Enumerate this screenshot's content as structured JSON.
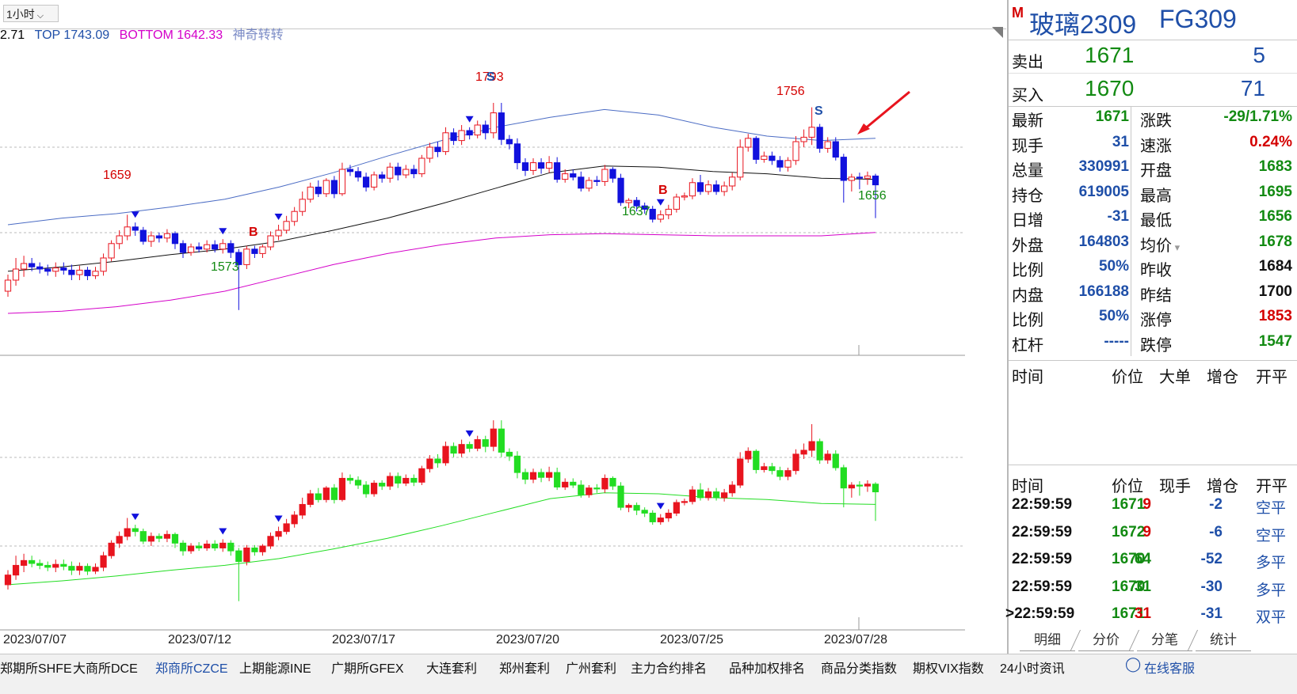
{
  "toolbar": {
    "period": "1小时"
  },
  "indicator": {
    "value": "2.71",
    "top_label": "TOP",
    "top_value": "1743.09",
    "bottom_label": "BOTTOM",
    "bottom_value": "1642.33",
    "name": "神奇转转"
  },
  "instrument": {
    "logo": "M",
    "name": "玻璃2309",
    "code": "FG309"
  },
  "orderbook": {
    "ask": {
      "label": "卖出",
      "price": "1671",
      "volume": "5"
    },
    "bid": {
      "label": "买入",
      "price": "1670",
      "volume": "71"
    }
  },
  "stats": [
    {
      "l": "最新",
      "v": "1671",
      "vc": "#128a12",
      "l2": "涨跌",
      "v2": "-29/1.71%",
      "v2c": "#128a12"
    },
    {
      "l": "现手",
      "v": "31",
      "vc": "#1f4fa8",
      "l2": "速涨",
      "v2": "0.24%",
      "v2c": "#d40000"
    },
    {
      "l": "总量",
      "v": "330991",
      "vc": "#1f4fa8",
      "l2": "开盘",
      "v2": "1683",
      "v2c": "#128a12"
    },
    {
      "l": "持仓",
      "v": "619005",
      "vc": "#1f4fa8",
      "l2": "最高",
      "v2": "1695",
      "v2c": "#128a12"
    },
    {
      "l": "日增",
      "v": "-31",
      "vc": "#1f4fa8",
      "l2": "最低",
      "v2": "1656",
      "v2c": "#128a12"
    },
    {
      "l": "外盘",
      "v": "164803",
      "vc": "#1f4fa8",
      "l2": "均价",
      "v2": "1678",
      "v2c": "#128a12"
    },
    {
      "l": "比例",
      "v": "50%",
      "vc": "#1f4fa8",
      "l2": "昨收",
      "v2": "1684",
      "v2c": "#111111"
    },
    {
      "l": "内盘",
      "v": "166188",
      "vc": "#1f4fa8",
      "l2": "昨结",
      "v2": "1700",
      "v2c": "#111111"
    },
    {
      "l": "比例",
      "v": "50%",
      "vc": "#1f4fa8",
      "l2": "涨停",
      "v2": "1853",
      "v2c": "#d40000"
    },
    {
      "l": "杠杆",
      "v": "-----",
      "vc": "#1f4fa8",
      "l2": "跌停",
      "v2": "1547",
      "v2c": "#128a12"
    }
  ],
  "bigorders": {
    "headers": [
      "时间",
      "价位",
      "大单",
      "增仓",
      "开平"
    ]
  },
  "ticks": {
    "headers": [
      "时间",
      "价位",
      "现手",
      "增仓",
      "开平"
    ],
    "rows": [
      {
        "time": "22:59:59",
        "price": "1671",
        "vol": "9",
        "volc": "#d40000",
        "oi": "-2",
        "type": "空平",
        "typec": "#1f4fa8",
        "cursor": ""
      },
      {
        "time": "22:59:59",
        "price": "1672",
        "vol": "9",
        "volc": "#d40000",
        "oi": "-6",
        "type": "空平",
        "typec": "#1f4fa8",
        "cursor": ""
      },
      {
        "time": "22:59:59",
        "price": "1670",
        "vol": "64",
        "volc": "#128a12",
        "oi": "-52",
        "type": "多平",
        "typec": "#1f4fa8",
        "cursor": ""
      },
      {
        "time": "22:59:59",
        "price": "1670",
        "vol": "31",
        "volc": "#128a12",
        "oi": "-30",
        "type": "多平",
        "typec": "#1f4fa8",
        "cursor": ""
      },
      {
        "time": "22:59:59",
        "price": "1671",
        "vol": "31",
        "volc": "#d40000",
        "oi": "-31",
        "type": "双平",
        "typec": "#1f4fa8",
        "cursor": ">"
      }
    ]
  },
  "tabs": [
    "明细",
    "分价",
    "分笔",
    "统计"
  ],
  "xaxis": [
    "2023/07/07",
    "2023/07/12",
    "2023/07/17",
    "2023/07/20",
    "2023/07/25",
    "2023/07/28"
  ],
  "statusbar": [
    "郑期所SHFE",
    "大商所DCE",
    "郑商所CZCE",
    "上期能源INE",
    "广期所GFEX",
    "大连套利",
    "郑州套利",
    "广州套利",
    "主力合约排名",
    "品种加权排名",
    "商品分类指数",
    "期权VIX指数",
    "24小时资讯",
    "在线客服"
  ],
  "colors": {
    "up": "#e8141e",
    "down": "#1111dd",
    "up_lower": "#e8141e",
    "down_lower": "#22dd22",
    "band_top": "#4b6cc4",
    "band_bottom": "#d400c9",
    "mid": "#111111",
    "status_highlight": "#1f4fa8"
  },
  "annotations": [
    "1659",
    "1573",
    "1793",
    "1637",
    "1756",
    "1656",
    "B",
    "B",
    "S",
    "S"
  ],
  "chart_data": {
    "type": "candlestick",
    "title": "",
    "ylim": [
      1540,
      1810
    ],
    "candles": [
      [
        1590,
        1600,
        1585,
        1605
      ],
      [
        1600,
        1610,
        1595,
        1620
      ],
      [
        1610,
        1615,
        1603,
        1622
      ],
      [
        1615,
        1612,
        1608,
        1620
      ],
      [
        1612,
        1610,
        1606,
        1616
      ],
      [
        1610,
        1608,
        1604,
        1614
      ],
      [
        1608,
        1611,
        1603,
        1616
      ],
      [
        1611,
        1609,
        1605,
        1616
      ],
      [
        1609,
        1605,
        1600,
        1614
      ],
      [
        1605,
        1609,
        1600,
        1613
      ],
      [
        1609,
        1604,
        1600,
        1612
      ],
      [
        1604,
        1608,
        1601,
        1612
      ],
      [
        1608,
        1620,
        1604,
        1624
      ],
      [
        1620,
        1633,
        1617,
        1636
      ],
      [
        1633,
        1640,
        1628,
        1645
      ],
      [
        1640,
        1648,
        1636,
        1659
      ],
      [
        1648,
        1645,
        1640,
        1652
      ],
      [
        1645,
        1635,
        1632,
        1648
      ],
      [
        1635,
        1640,
        1630,
        1644
      ],
      [
        1640,
        1638,
        1634,
        1643
      ],
      [
        1638,
        1642,
        1634,
        1646
      ],
      [
        1642,
        1633,
        1628,
        1644
      ],
      [
        1633,
        1625,
        1620,
        1636
      ],
      [
        1625,
        1630,
        1622,
        1633
      ],
      [
        1630,
        1628,
        1625,
        1634
      ],
      [
        1628,
        1632,
        1625,
        1636
      ],
      [
        1632,
        1628,
        1625,
        1636
      ],
      [
        1628,
        1633,
        1624,
        1637
      ],
      [
        1633,
        1625,
        1620,
        1636
      ],
      [
        1625,
        1614,
        1573,
        1628
      ],
      [
        1614,
        1628,
        1610,
        1631
      ],
      [
        1628,
        1624,
        1620,
        1631
      ],
      [
        1624,
        1630,
        1620,
        1632
      ],
      [
        1630,
        1640,
        1627,
        1644
      ],
      [
        1640,
        1645,
        1636,
        1650
      ],
      [
        1645,
        1653,
        1642,
        1658
      ],
      [
        1653,
        1662,
        1649,
        1666
      ],
      [
        1662,
        1673,
        1658,
        1680
      ],
      [
        1673,
        1684,
        1670,
        1688
      ],
      [
        1684,
        1678,
        1675,
        1690
      ],
      [
        1678,
        1690,
        1675,
        1692
      ],
      [
        1690,
        1678,
        1674,
        1694
      ],
      [
        1678,
        1700,
        1676,
        1706
      ],
      [
        1700,
        1698,
        1694,
        1704
      ],
      [
        1698,
        1693,
        1689,
        1702
      ],
      [
        1693,
        1684,
        1680,
        1697
      ],
      [
        1684,
        1695,
        1681,
        1698
      ],
      [
        1695,
        1692,
        1688,
        1698
      ],
      [
        1692,
        1702,
        1688,
        1706
      ],
      [
        1702,
        1695,
        1690,
        1706
      ],
      [
        1695,
        1700,
        1692,
        1704
      ],
      [
        1700,
        1696,
        1692,
        1704
      ],
      [
        1696,
        1710,
        1693,
        1713
      ],
      [
        1710,
        1720,
        1706,
        1724
      ],
      [
        1720,
        1716,
        1711,
        1725
      ],
      [
        1716,
        1733,
        1713,
        1738
      ],
      [
        1733,
        1726,
        1722,
        1737
      ],
      [
        1726,
        1735,
        1722,
        1740
      ],
      [
        1735,
        1731,
        1727,
        1738
      ],
      [
        1731,
        1740,
        1728,
        1744
      ],
      [
        1740,
        1733,
        1727,
        1744
      ],
      [
        1733,
        1751,
        1728,
        1760
      ],
      [
        1751,
        1727,
        1722,
        1760
      ],
      [
        1727,
        1723,
        1718,
        1731
      ],
      [
        1723,
        1706,
        1700,
        1728
      ],
      [
        1706,
        1699,
        1694,
        1710
      ],
      [
        1699,
        1706,
        1695,
        1710
      ],
      [
        1706,
        1701,
        1696,
        1710
      ],
      [
        1701,
        1706,
        1697,
        1712
      ],
      [
        1706,
        1691,
        1688,
        1711
      ],
      [
        1691,
        1696,
        1688,
        1700
      ],
      [
        1696,
        1693,
        1690,
        1700
      ],
      [
        1693,
        1683,
        1680,
        1698
      ],
      [
        1683,
        1690,
        1680,
        1693
      ],
      [
        1690,
        1689,
        1685,
        1694
      ],
      [
        1689,
        1700,
        1685,
        1704
      ],
      [
        1700,
        1692,
        1688,
        1702
      ],
      [
        1692,
        1670,
        1667,
        1696
      ],
      [
        1670,
        1672,
        1665,
        1674
      ],
      [
        1672,
        1667,
        1662,
        1675
      ],
      [
        1667,
        1664,
        1660,
        1670
      ],
      [
        1664,
        1655,
        1652,
        1667
      ],
      [
        1655,
        1659,
        1652,
        1663
      ],
      [
        1659,
        1664,
        1655,
        1668
      ],
      [
        1664,
        1675,
        1661,
        1678
      ],
      [
        1675,
        1676,
        1672,
        1679
      ],
      [
        1676,
        1688,
        1673,
        1692
      ],
      [
        1688,
        1680,
        1677,
        1695
      ],
      [
        1680,
        1686,
        1677,
        1690
      ],
      [
        1686,
        1680,
        1677,
        1690
      ],
      [
        1680,
        1685,
        1676,
        1689
      ],
      [
        1685,
        1693,
        1681,
        1697
      ],
      [
        1693,
        1720,
        1690,
        1727
      ],
      [
        1720,
        1728,
        1716,
        1732
      ],
      [
        1728,
        1709,
        1705,
        1730
      ],
      [
        1709,
        1712,
        1706,
        1716
      ],
      [
        1712,
        1708,
        1704,
        1716
      ],
      [
        1708,
        1702,
        1698,
        1712
      ],
      [
        1702,
        1708,
        1698,
        1711
      ],
      [
        1708,
        1725,
        1704,
        1730
      ],
      [
        1725,
        1729,
        1720,
        1736
      ],
      [
        1729,
        1738,
        1722,
        1756
      ],
      [
        1738,
        1719,
        1715,
        1741
      ],
      [
        1719,
        1725,
        1715,
        1729
      ],
      [
        1725,
        1711,
        1708,
        1729
      ],
      [
        1711,
        1690,
        1670,
        1714
      ],
      [
        1690,
        1693,
        1680,
        1696
      ],
      [
        1693,
        1692,
        1682,
        1697
      ],
      [
        1692,
        1694,
        1686,
        1698
      ],
      [
        1694,
        1686,
        1656,
        1696
      ]
    ],
    "band_top": [
      1650,
      1656,
      1660,
      1666,
      1673,
      1684,
      1697,
      1712,
      1726,
      1738,
      1747,
      1754,
      1749,
      1738,
      1730,
      1726,
      1728
    ],
    "band_bottom": [
      1570,
      1572,
      1576,
      1582,
      1590,
      1602,
      1614,
      1624,
      1632,
      1638,
      1641,
      1642,
      1641,
      1640,
      1640,
      1640,
      1643
    ],
    "mid_line": [
      1608,
      1612,
      1617,
      1623,
      1628,
      1635,
      1645,
      1656,
      1669,
      1683,
      1697,
      1703,
      1702,
      1698,
      1696,
      1692,
      1691
    ]
  }
}
